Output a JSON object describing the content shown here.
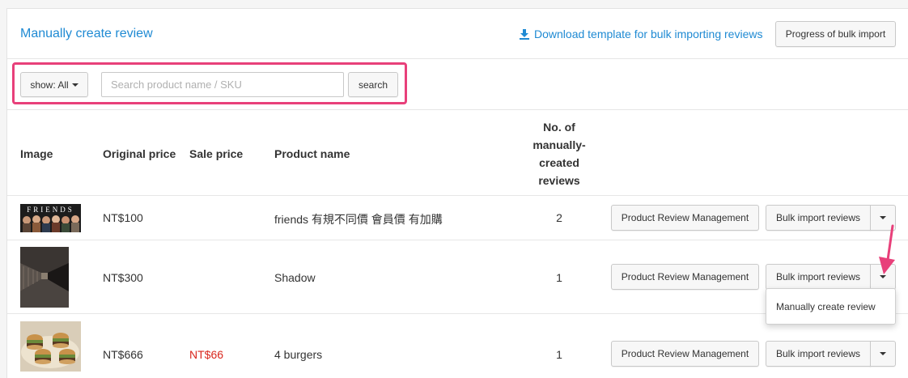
{
  "header": {
    "title": "Manually create review",
    "download_link": "Download template for bulk importing reviews",
    "progress_button": "Progress of bulk import"
  },
  "filter": {
    "show_label": "show: All",
    "search_placeholder": "Search product name / SKU",
    "search_button": "search"
  },
  "table": {
    "headers": {
      "image": "Image",
      "original_price": "Original price",
      "sale_price": "Sale price",
      "product_name": "Product name",
      "count_line1": "No. of",
      "count_line2": "manually-",
      "count_line3": "created",
      "count_line4": "reviews"
    },
    "rows": [
      {
        "original_price": "NT$100",
        "sale_price": "",
        "product_name": "friends 有規不同價 會員價 有加購",
        "count": "2",
        "image_icon": "friends-thumbnail"
      },
      {
        "original_price": "NT$300",
        "sale_price": "",
        "product_name": "Shadow",
        "count": "1",
        "image_icon": "corridor-thumbnail"
      },
      {
        "original_price": "NT$666",
        "sale_price": "NT$66",
        "product_name": "4 burgers",
        "count": "1",
        "image_icon": "burgers-thumbnail"
      }
    ],
    "row_actions": {
      "manage_button": "Product Review Management",
      "bulk_button": "Bulk import reviews"
    }
  },
  "dropdown": {
    "item": "Manually create review"
  },
  "colors": {
    "accent": "#1f8ad3",
    "highlight": "#e8407a",
    "sale_red": "#d9261c"
  }
}
